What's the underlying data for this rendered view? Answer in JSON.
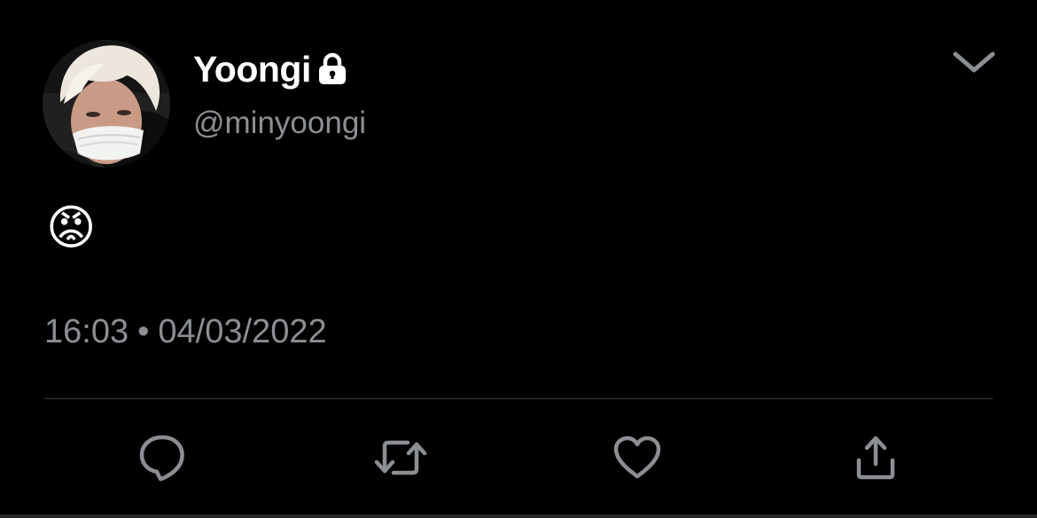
{
  "tweet": {
    "author": {
      "display_name": "Yoongi",
      "handle": "@minyoongi",
      "protected_icon": "lock-icon",
      "avatar": "avatar-photo"
    },
    "text": "😡",
    "time": "16:03",
    "separator": "•",
    "date": "04/03/2022"
  },
  "actions": [
    {
      "name": "reply",
      "icon": "reply-bubble-icon"
    },
    {
      "name": "retweet",
      "icon": "retweet-icon"
    },
    {
      "name": "like",
      "icon": "heart-icon"
    },
    {
      "name": "share",
      "icon": "share-icon"
    }
  ],
  "menu_icon": "chevron-down-icon",
  "colors": {
    "background": "#000000",
    "primary_text": "#ffffff",
    "secondary_text": "#8b8f94",
    "icon": "#8b8f94",
    "divider": "#3a3d42"
  }
}
